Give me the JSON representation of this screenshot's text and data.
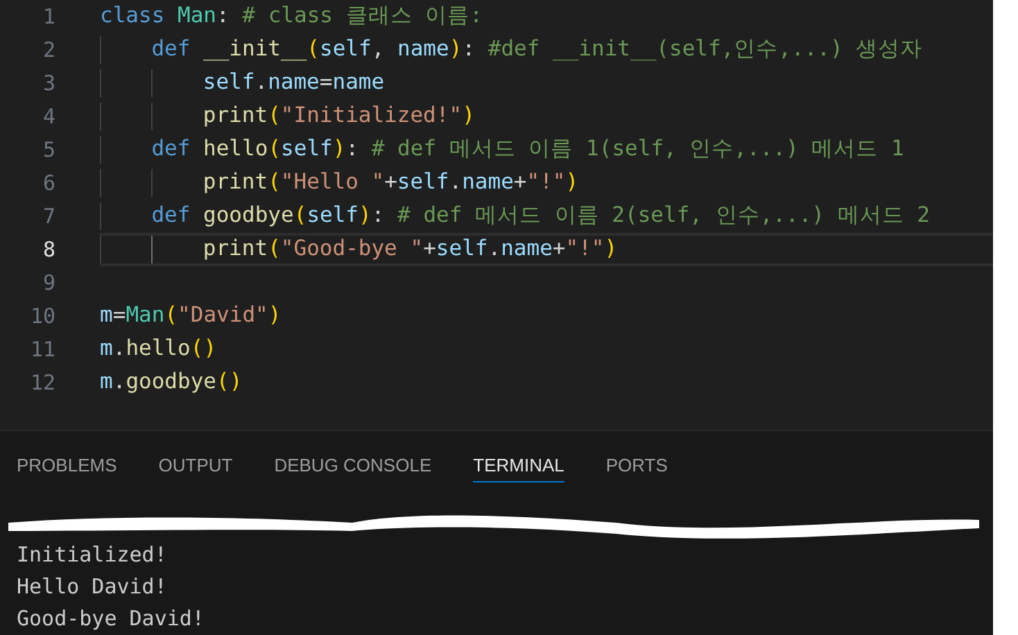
{
  "editor": {
    "lines": [
      {
        "number": "1",
        "current": false,
        "tokens": [
          {
            "kind": "keyword",
            "text": "class "
          },
          {
            "kind": "class",
            "text": "Man"
          },
          {
            "kind": "plain",
            "text": ": "
          },
          {
            "kind": "comment",
            "text": "# class 클래스 이름:"
          }
        ],
        "children": [
          {
            "number": "2",
            "current": false,
            "tokens": [
              {
                "kind": "keyword",
                "text": "def "
              },
              {
                "kind": "function",
                "text": "__init__"
              },
              {
                "kind": "bracket",
                "text": "("
              },
              {
                "kind": "param",
                "text": "self"
              },
              {
                "kind": "plain",
                "text": ", "
              },
              {
                "kind": "param",
                "text": "name"
              },
              {
                "kind": "bracket",
                "text": ")"
              },
              {
                "kind": "plain",
                "text": ": "
              },
              {
                "kind": "comment",
                "text": "#def __init__(self,인수,...) 생성자"
              }
            ],
            "children": [
              {
                "number": "3",
                "current": false,
                "tokens": [
                  {
                    "kind": "param",
                    "text": "self"
                  },
                  {
                    "kind": "plain",
                    "text": "."
                  },
                  {
                    "kind": "param",
                    "text": "name"
                  },
                  {
                    "kind": "plain",
                    "text": "="
                  },
                  {
                    "kind": "param",
                    "text": "name"
                  }
                ]
              },
              {
                "number": "4",
                "current": false,
                "tokens": [
                  {
                    "kind": "function",
                    "text": "print"
                  },
                  {
                    "kind": "bracket",
                    "text": "("
                  },
                  {
                    "kind": "string",
                    "text": "\"Initialized!\""
                  },
                  {
                    "kind": "bracket",
                    "text": ")"
                  }
                ]
              }
            ]
          },
          {
            "number": "5",
            "current": false,
            "tokens": [
              {
                "kind": "keyword",
                "text": "def "
              },
              {
                "kind": "function",
                "text": "hello"
              },
              {
                "kind": "bracket",
                "text": "("
              },
              {
                "kind": "param",
                "text": "self"
              },
              {
                "kind": "bracket",
                "text": ")"
              },
              {
                "kind": "plain",
                "text": ": "
              },
              {
                "kind": "comment",
                "text": "# def 메서드 이름 1(self, 인수,...) 메서드 1"
              }
            ],
            "children": [
              {
                "number": "6",
                "current": false,
                "tokens": [
                  {
                    "kind": "function",
                    "text": "print"
                  },
                  {
                    "kind": "bracket",
                    "text": "("
                  },
                  {
                    "kind": "string",
                    "text": "\"Hello \""
                  },
                  {
                    "kind": "plain",
                    "text": "+"
                  },
                  {
                    "kind": "param",
                    "text": "self"
                  },
                  {
                    "kind": "plain",
                    "text": "."
                  },
                  {
                    "kind": "param",
                    "text": "name"
                  },
                  {
                    "kind": "plain",
                    "text": "+"
                  },
                  {
                    "kind": "string",
                    "text": "\"!\""
                  },
                  {
                    "kind": "bracket",
                    "text": ")"
                  }
                ]
              }
            ]
          },
          {
            "number": "7",
            "current": false,
            "tokens": [
              {
                "kind": "keyword",
                "text": "def "
              },
              {
                "kind": "function",
                "text": "goodbye"
              },
              {
                "kind": "bracket",
                "text": "("
              },
              {
                "kind": "param",
                "text": "self"
              },
              {
                "kind": "bracket",
                "text": ")"
              },
              {
                "kind": "plain",
                "text": ": "
              },
              {
                "kind": "comment",
                "text": "# def 메서드 이름 2(self, 인수,...) 메서드 2"
              }
            ],
            "children": [
              {
                "number": "8",
                "current": true,
                "tokens": [
                  {
                    "kind": "function",
                    "text": "print"
                  },
                  {
                    "kind": "bracket",
                    "text": "("
                  },
                  {
                    "kind": "string",
                    "text": "\"Good-bye \""
                  },
                  {
                    "kind": "plain",
                    "text": "+"
                  },
                  {
                    "kind": "param",
                    "text": "self"
                  },
                  {
                    "kind": "plain",
                    "text": "."
                  },
                  {
                    "kind": "param",
                    "text": "name"
                  },
                  {
                    "kind": "plain",
                    "text": "+"
                  },
                  {
                    "kind": "string",
                    "text": "\"!\""
                  },
                  {
                    "kind": "bracket",
                    "text": ")"
                  }
                ]
              }
            ]
          }
        ]
      },
      {
        "number": "9",
        "current": false
      },
      {
        "number": "10",
        "current": false,
        "tokens": [
          {
            "kind": "param",
            "text": "m"
          },
          {
            "kind": "plain",
            "text": "="
          },
          {
            "kind": "class",
            "text": "Man"
          },
          {
            "kind": "bracket",
            "text": "("
          },
          {
            "kind": "string",
            "text": "\"David\""
          },
          {
            "kind": "bracket",
            "text": ")"
          }
        ]
      },
      {
        "number": "11",
        "current": false,
        "tokens": [
          {
            "kind": "param",
            "text": "m"
          },
          {
            "kind": "plain",
            "text": "."
          },
          {
            "kind": "function",
            "text": "hello"
          },
          {
            "kind": "bracket",
            "text": "()"
          }
        ]
      },
      {
        "number": "12",
        "current": false,
        "tokens": [
          {
            "kind": "param",
            "text": "m"
          },
          {
            "kind": "plain",
            "text": "."
          },
          {
            "kind": "function",
            "text": "goodbye"
          },
          {
            "kind": "bracket",
            "text": "()"
          }
        ]
      }
    ]
  },
  "panel": {
    "tabs": [
      {
        "label": "PROBLEMS",
        "selected": false
      },
      {
        "label": "OUTPUT",
        "selected": false
      },
      {
        "label": "DEBUG CONSOLE",
        "selected": false
      },
      {
        "label": "TERMINAL",
        "selected": true
      },
      {
        "label": "PORTS",
        "selected": false
      }
    ],
    "terminal": {
      "redacted_line": true,
      "lines": [
        "Initialized!",
        "Hello David!",
        "Good-bye David!"
      ]
    }
  }
}
